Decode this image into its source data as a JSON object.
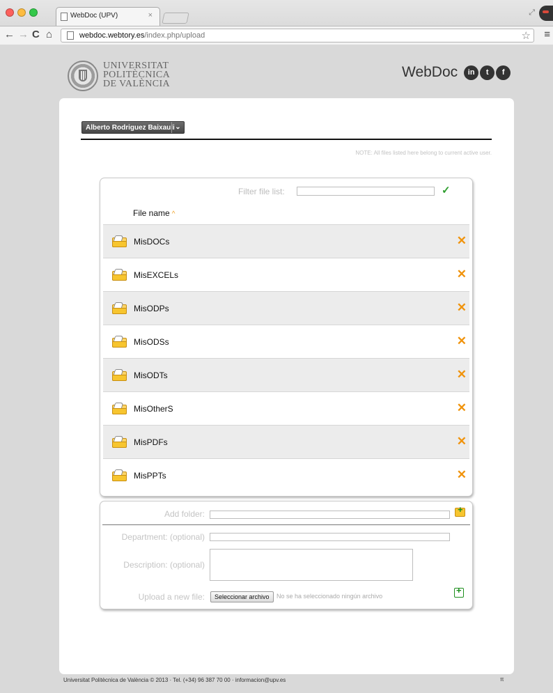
{
  "browser": {
    "tab_title": "WebDoc (UPV)",
    "tab_close": "×",
    "url_host": "webdoc.webtory.es",
    "url_path": "/index.php/upload",
    "back": "←",
    "forward": "→",
    "reload": "C",
    "home": "⌂",
    "star": "☆",
    "menu": "≡",
    "expand": "⤢"
  },
  "header": {
    "university": "UNIVERSITAT\nPOLITÈCNICA\nDE VALÈNCIA",
    "brand": "WebDoc",
    "social": [
      {
        "icon": "linkedin-icon",
        "label": "in"
      },
      {
        "icon": "twitter-icon",
        "label": "t"
      },
      {
        "icon": "facebook-icon",
        "label": "f"
      }
    ]
  },
  "user": {
    "name": "Alberto Rodriguez Baixauli",
    "arrow": "⌄"
  },
  "note": "NOTE: All files listed here belong to current active user.",
  "filelist": {
    "filter_label": "Filter file list:",
    "filter_value": "",
    "confirm": "✓",
    "column_header": "File name",
    "sort_indicator": "^",
    "delete": "✕",
    "rows": [
      "MisDOCs",
      "MisEXCELs",
      "MisODPs",
      "MisODSs",
      "MisODTs",
      "MisOtherS",
      "MisPDFs",
      "MisPPTs"
    ]
  },
  "form": {
    "add_folder_label": "Add folder:",
    "department_label": "Department: (optional)",
    "description_label": "Description: (optional)",
    "upload_label": "Upload a new file:",
    "file_button": "Seleccionar archivo",
    "file_status": "No se ha seleccionado ningún archivo"
  },
  "footer": {
    "text": "Universitat Politècnica de València © 2013 · Tel. (+34) 96 387 70 00 · informacion@upv.es",
    "pi": "π"
  },
  "colors": {
    "accent_delete": "#f0930c",
    "confirm_green": "#2f9e2f",
    "folder_yellow": "#f7c52f"
  }
}
